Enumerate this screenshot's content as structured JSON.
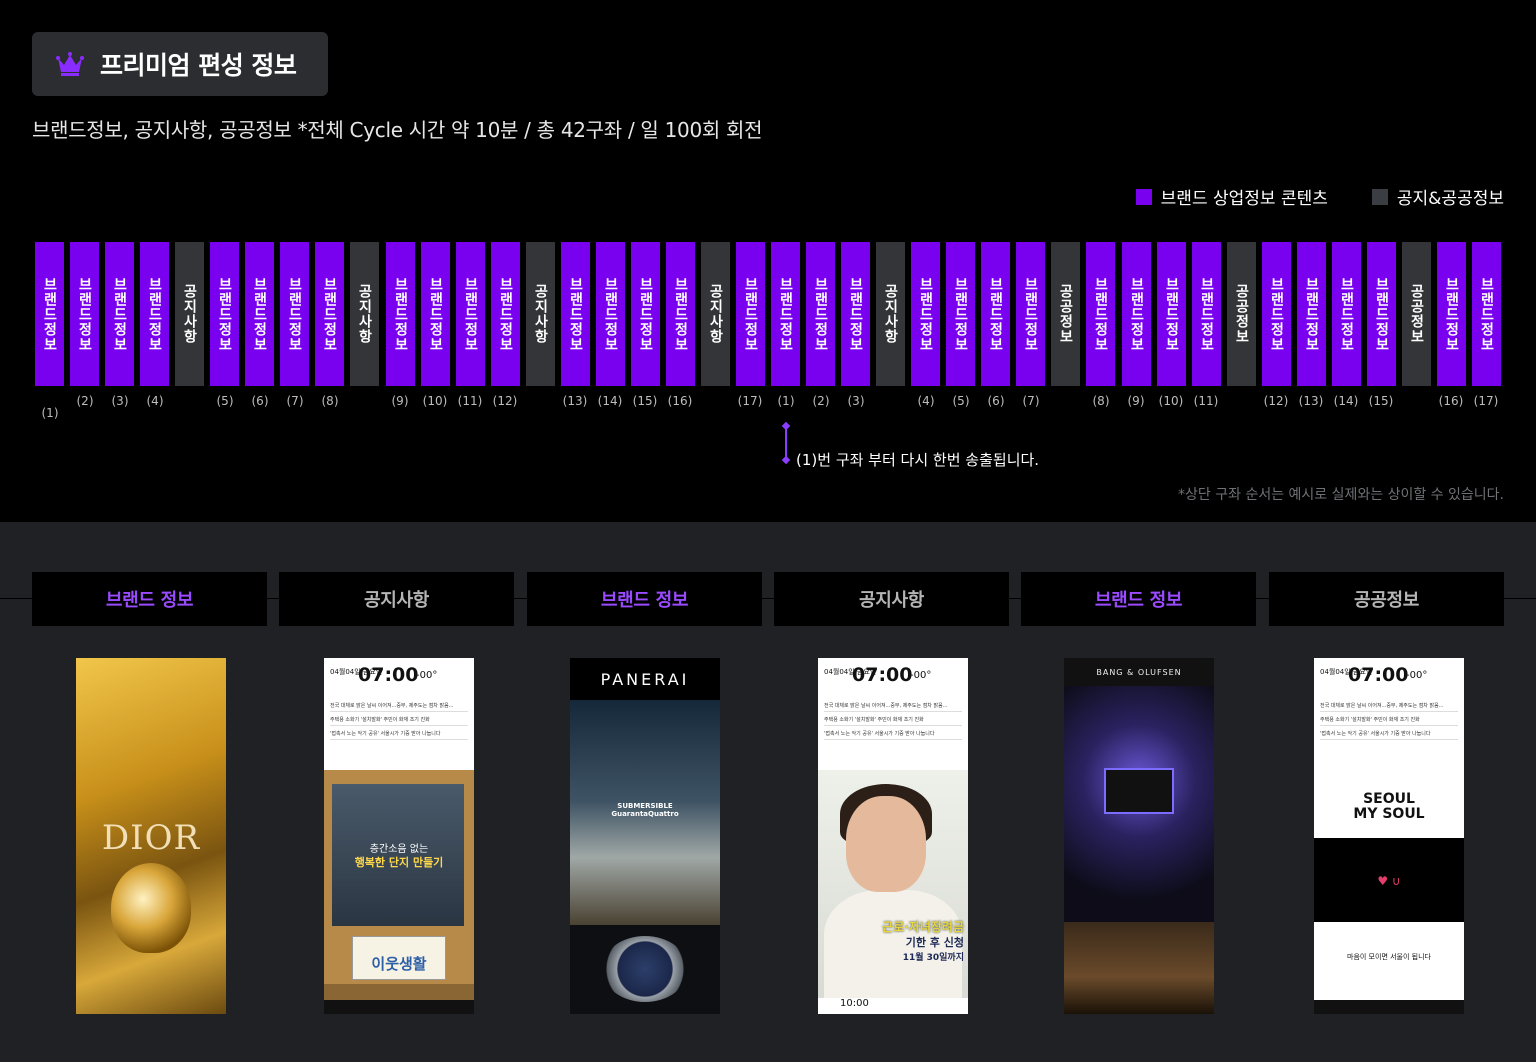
{
  "title": {
    "text": "프리미엄 편성 정보"
  },
  "subtitle": "브랜드정보, 공지사항, 공공정보 *전체 Cycle 시간 약 10분 / 총 42구좌 / 일 100회 회전",
  "legend": [
    {
      "label": "브랜드 상업정보 콘텐츠",
      "color": "#7a00f0"
    },
    {
      "label": "공지&공공정보",
      "color": "#3a3d42"
    }
  ],
  "colors": {
    "brand": "#7a00f0",
    "notice": "#333539"
  },
  "slots": [
    {
      "text": "브랜드정보",
      "kind": "brand",
      "num": "(1)"
    },
    {
      "text": "브랜드정보",
      "kind": "brand",
      "num": "(2)"
    },
    {
      "text": "브랜드정보",
      "kind": "brand",
      "num": "(3)"
    },
    {
      "text": "브랜드정보",
      "kind": "brand",
      "num": "(4)"
    },
    {
      "text": "공지사항",
      "kind": "notice",
      "num": ""
    },
    {
      "text": "브랜드정보",
      "kind": "brand",
      "num": "(5)"
    },
    {
      "text": "브랜드정보",
      "kind": "brand",
      "num": "(6)"
    },
    {
      "text": "브랜드정보",
      "kind": "brand",
      "num": "(7)"
    },
    {
      "text": "브랜드정보",
      "kind": "brand",
      "num": "(8)"
    },
    {
      "text": "공지사항",
      "kind": "notice",
      "num": ""
    },
    {
      "text": "브랜드정보",
      "kind": "brand",
      "num": "(9)"
    },
    {
      "text": "브랜드정보",
      "kind": "brand",
      "num": "(10)"
    },
    {
      "text": "브랜드정보",
      "kind": "brand",
      "num": "(11)"
    },
    {
      "text": "브랜드정보",
      "kind": "brand",
      "num": "(12)"
    },
    {
      "text": "공지사항",
      "kind": "notice",
      "num": ""
    },
    {
      "text": "브랜드정보",
      "kind": "brand",
      "num": "(13)"
    },
    {
      "text": "브랜드정보",
      "kind": "brand",
      "num": "(14)"
    },
    {
      "text": "브랜드정보",
      "kind": "brand",
      "num": "(15)"
    },
    {
      "text": "브랜드정보",
      "kind": "brand",
      "num": "(16)"
    },
    {
      "text": "공지사항",
      "kind": "notice",
      "num": ""
    },
    {
      "text": "브랜드정보",
      "kind": "brand",
      "num": "(17)"
    },
    {
      "text": "브랜드정보",
      "kind": "brand",
      "num": "(1)"
    },
    {
      "text": "브랜드정보",
      "kind": "brand",
      "num": "(2)"
    },
    {
      "text": "브랜드정보",
      "kind": "brand",
      "num": "(3)"
    },
    {
      "text": "공지사항",
      "kind": "notice",
      "num": ""
    },
    {
      "text": "브랜드정보",
      "kind": "brand",
      "num": "(4)"
    },
    {
      "text": "브랜드정보",
      "kind": "brand",
      "num": "(5)"
    },
    {
      "text": "브랜드정보",
      "kind": "brand",
      "num": "(6)"
    },
    {
      "text": "브랜드정보",
      "kind": "brand",
      "num": "(7)"
    },
    {
      "text": "공공정보",
      "kind": "notice",
      "num": ""
    },
    {
      "text": "브랜드정보",
      "kind": "brand",
      "num": "(8)"
    },
    {
      "text": "브랜드정보",
      "kind": "brand",
      "num": "(9)"
    },
    {
      "text": "브랜드정보",
      "kind": "brand",
      "num": "(10)"
    },
    {
      "text": "브랜드정보",
      "kind": "brand",
      "num": "(11)"
    },
    {
      "text": "공공정보",
      "kind": "notice",
      "num": ""
    },
    {
      "text": "브랜드정보",
      "kind": "brand",
      "num": "(12)"
    },
    {
      "text": "브랜드정보",
      "kind": "brand",
      "num": "(13)"
    },
    {
      "text": "브랜드정보",
      "kind": "brand",
      "num": "(14)"
    },
    {
      "text": "브랜드정보",
      "kind": "brand",
      "num": "(15)"
    },
    {
      "text": "공공정보",
      "kind": "notice",
      "num": ""
    },
    {
      "text": "브랜드정보",
      "kind": "brand",
      "num": "(16)"
    },
    {
      "text": "브랜드정보",
      "kind": "brand",
      "num": "(17)"
    }
  ],
  "note": "(1)번 구좌 부터 다시 한번 송출됩니다.",
  "disclaimer": "*상단 구좌 순서는 예시로 실제와는 상이할 수 있습니다.",
  "cards": [
    {
      "label": "브랜드 정보",
      "kind": "brand"
    },
    {
      "label": "공지사항",
      "kind": "notice"
    },
    {
      "label": "브랜드 정보",
      "kind": "brand"
    },
    {
      "label": "공지사항",
      "kind": "notice"
    },
    {
      "label": "브랜드 정보",
      "kind": "brand"
    },
    {
      "label": "공공정보",
      "kind": "notice"
    }
  ],
  "posters": {
    "dior": {
      "logo": "DIOR"
    },
    "notice_a": {
      "date": "04월04일 금요일",
      "time": "07:00",
      "temp": "-00°",
      "rows": [
        "전국 대체로 맑은 날씨 이어져...중부, 제주도는 점차 맑음...",
        "주택용 소화기 '설치발화' 주민이 화재 조기 진화",
        "'접촉서 노는 악기 공유' 서울시가 기증 받아 나눕니다"
      ],
      "line1": "층간소음 없는",
      "line2": "행복한 단지 만들기",
      "card": "이웃생활"
    },
    "panerai": {
      "brand": "PANERAI",
      "sub1": "SUBMERSIBLE",
      "sub2": "GuarantaQuattro"
    },
    "notice_b": {
      "date": "04월04일 금요일",
      "time": "07:00",
      "temp": "-00°",
      "rows": [
        "전국 대체로 맑은 날씨 이어져...중부, 제주도는 점차 맑음...",
        "주택용 소화기 '설치발화' 주민이 화재 조기 진화",
        "'접촉서 노는 악기 공유' 서울시가 기증 받아 나눕니다"
      ],
      "h1": "근로·자녀장려금",
      "h2": "기한 후 신청",
      "h3": "11월 30일까지",
      "bottom_time": "10:00"
    },
    "bo": {
      "brand": "BANG & OLUFSEN"
    },
    "notice_c": {
      "date": "04월04일 금요일",
      "time": "07:00",
      "temp": "-00°",
      "rows": [
        "전국 대체로 맑은 날씨 이어져...중부, 제주도는 점차 맑음...",
        "주택용 소화기 '설치발화' 주민이 화재 조기 진화",
        "'접촉서 노는 악기 공유' 서울시가 기증 받아 나눕니다"
      ],
      "seoul1": "SEOUL",
      "seoul2": "MY SOUL",
      "mid": "♥ ∪",
      "slogan": "마음이 모이면 서울이 됩니다"
    }
  }
}
